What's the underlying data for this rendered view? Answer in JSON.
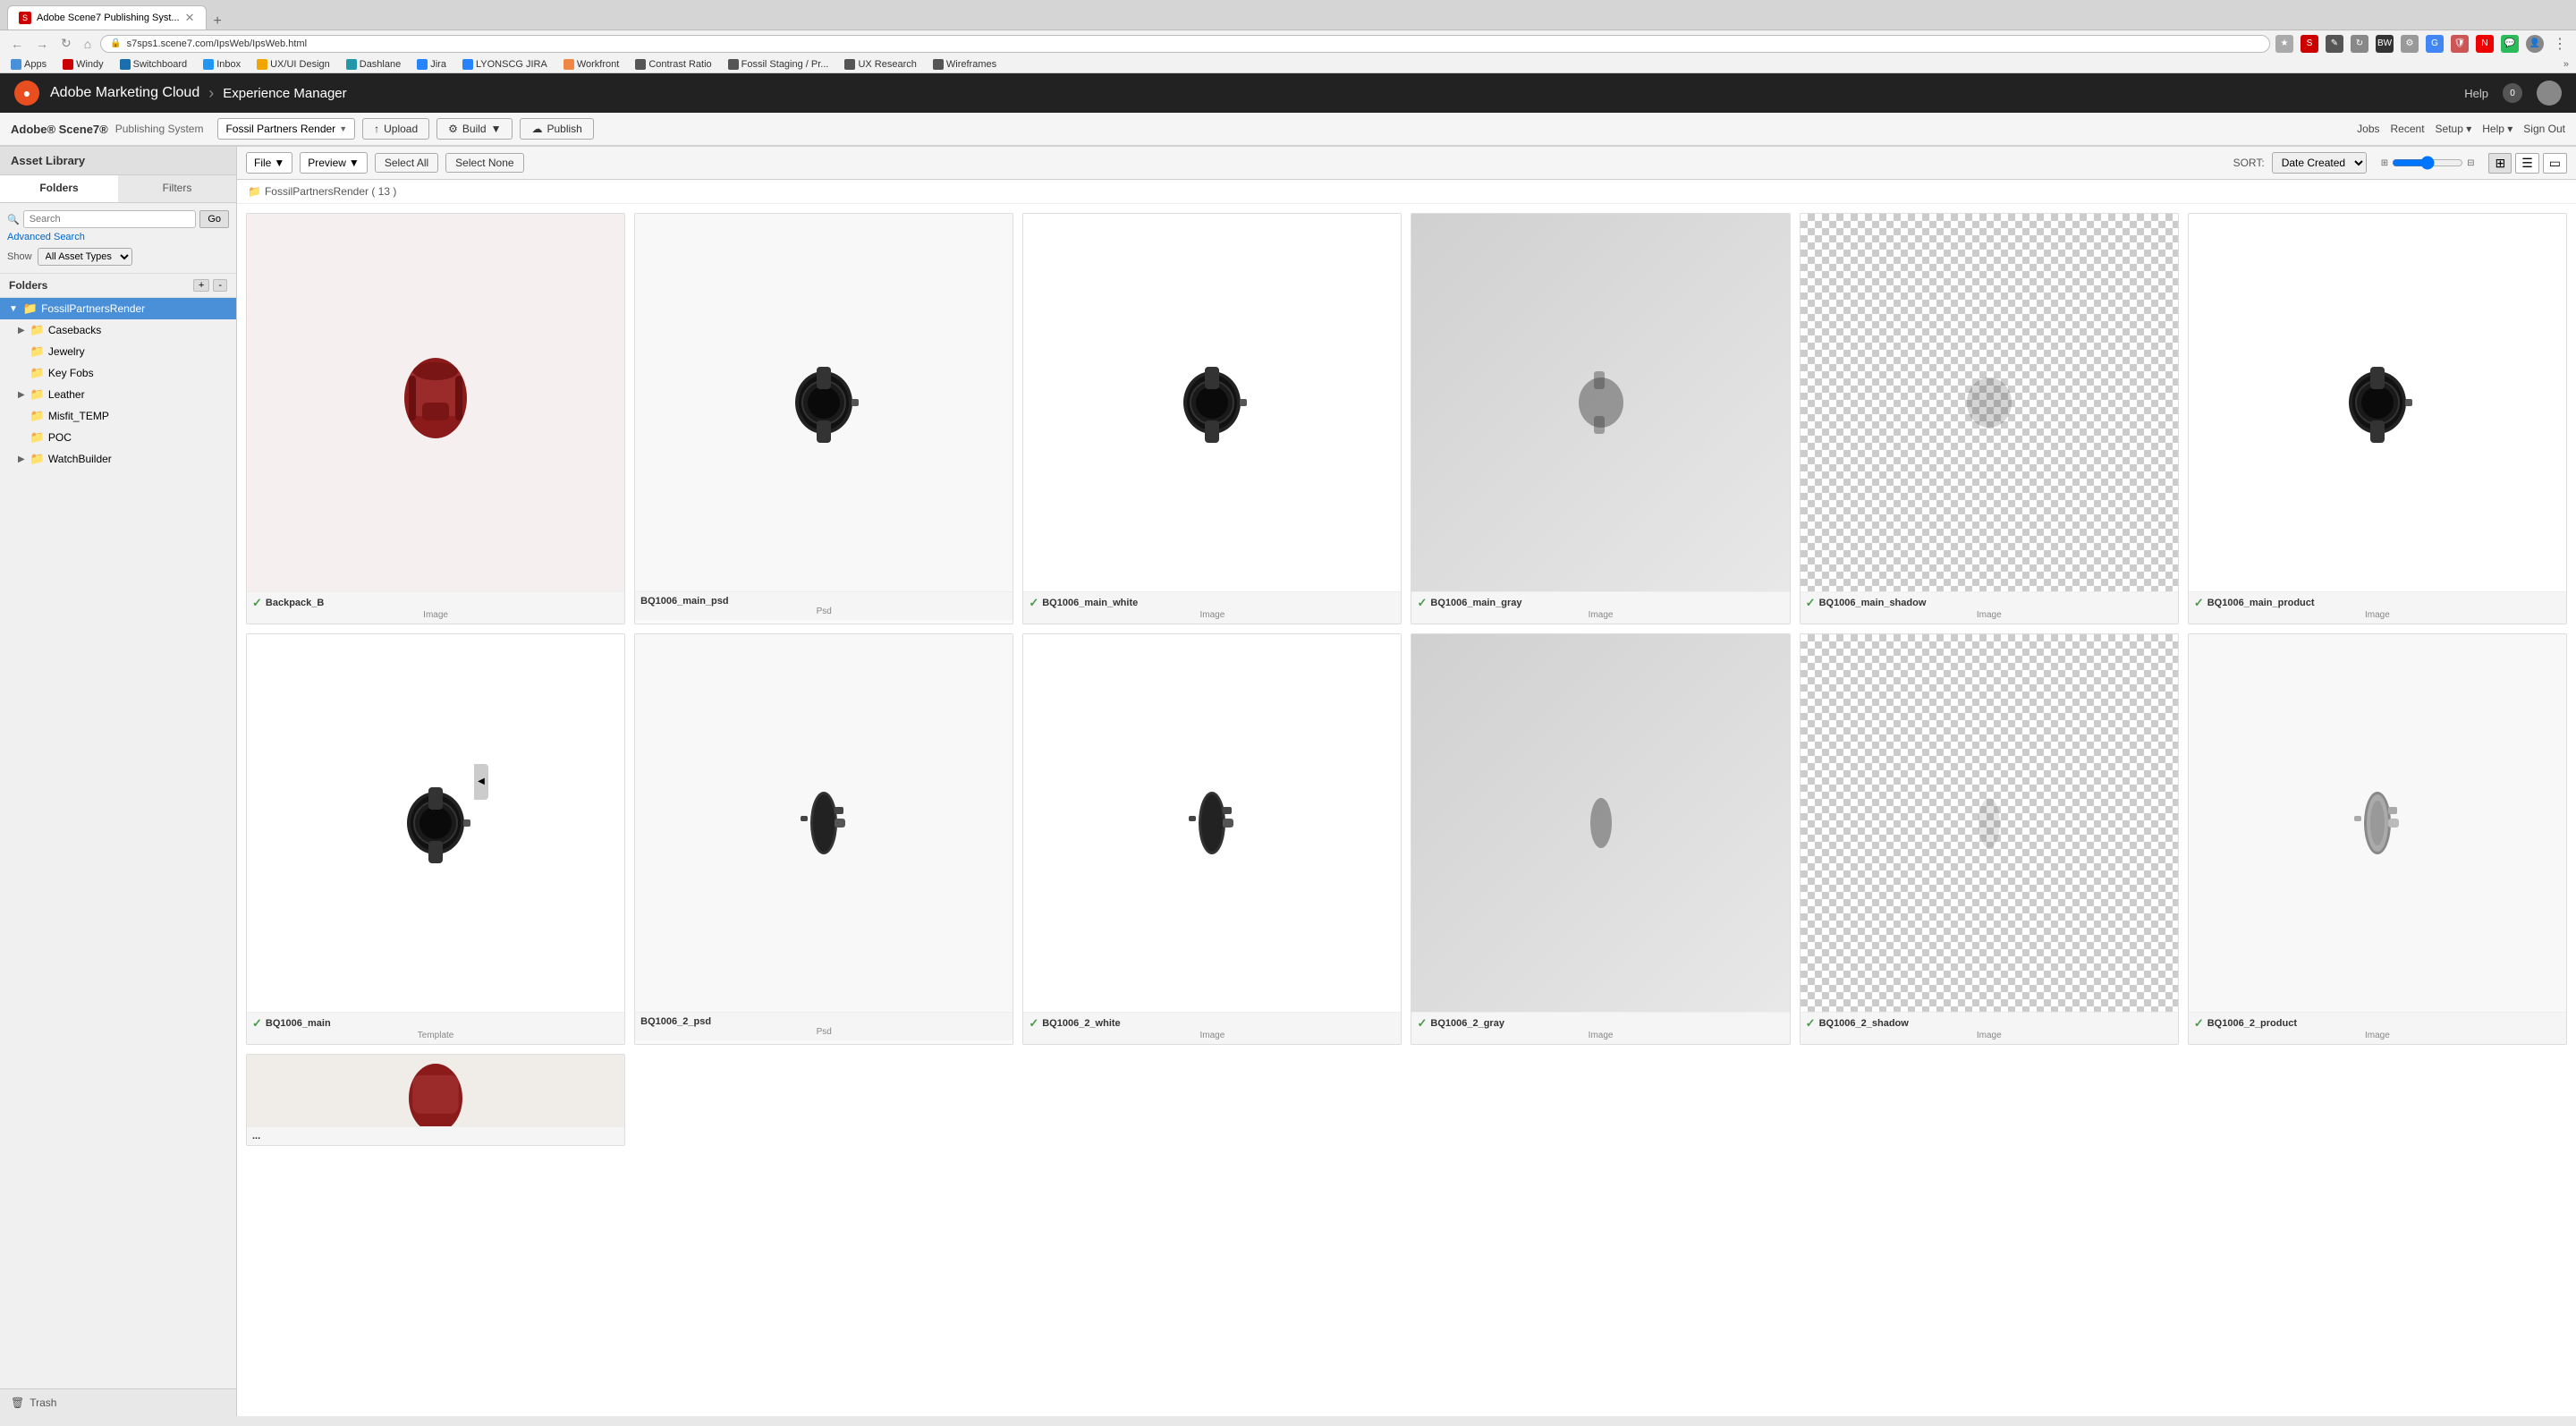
{
  "browser": {
    "tab_label": "Adobe Scene7 Publishing Syst...",
    "tab_plus": "+",
    "address": "s7sps1.scene7.com/IpsWeb/IpsWeb.html",
    "back": "←",
    "forward": "→",
    "refresh": "↻",
    "home": "⌂",
    "more": "⋯"
  },
  "bookmarks": [
    {
      "label": "Apps",
      "color": "#4a90d9"
    },
    {
      "label": "Windy",
      "color": "#c00"
    },
    {
      "label": "Switchboard",
      "color": "#1a6faf"
    },
    {
      "label": "Inbox",
      "color": "#2196F3"
    },
    {
      "label": "UX/UI Design",
      "color": "#f0a500"
    },
    {
      "label": "Dashlane",
      "color": "#29a"
    },
    {
      "label": "Jira",
      "color": "#2684FF"
    },
    {
      "label": "LYONSCG JIRA",
      "color": "#2684FF"
    },
    {
      "label": "Workfront",
      "color": "#e84"
    },
    {
      "label": "Contrast Ratio",
      "color": "#555"
    },
    {
      "label": "Fossil Staging / Pr...",
      "color": "#555"
    },
    {
      "label": "UX Research",
      "color": "#555"
    },
    {
      "label": "Wireframes",
      "color": "#555"
    }
  ],
  "app_header": {
    "logo": "●",
    "title": "Adobe Marketing Cloud",
    "separator": "›",
    "subtitle": "Experience Manager",
    "help": "Help",
    "notification_count": "0"
  },
  "pub_bar": {
    "brand": "Adobe® Scene7®",
    "system": "Publishing System",
    "dropdown_label": "Fossil Partners Render",
    "btn_upload": "Upload",
    "btn_build": "Build",
    "btn_publish": "Publish",
    "jobs": "Jobs",
    "recent": "Recent",
    "setup": "Setup ▾",
    "help": "Help ▾",
    "signout": "Sign Out"
  },
  "sidebar": {
    "title": "Asset Library",
    "tabs": [
      "Folders",
      "Filters"
    ],
    "search_placeholder": "Search",
    "search_go": "Go",
    "advanced_search": "Advanced Search",
    "show_label": "Show",
    "show_options": [
      "All Asset Types"
    ],
    "folders_label": "Folders",
    "folders_add": "+",
    "folders_remove": "-",
    "tree": [
      {
        "label": "FossilPartnersRender",
        "level": 0,
        "expanded": true,
        "selected": true,
        "has_children": true
      },
      {
        "label": "Casebacks",
        "level": 1,
        "expanded": false,
        "has_children": true
      },
      {
        "label": "Jewelry",
        "level": 1,
        "expanded": false,
        "has_children": false
      },
      {
        "label": "Key Fobs",
        "level": 1,
        "expanded": false,
        "has_children": false
      },
      {
        "label": "Leather",
        "level": 1,
        "expanded": false,
        "has_children": true
      },
      {
        "label": "Misfit_TEMP",
        "level": 1,
        "expanded": false,
        "has_children": false
      },
      {
        "label": "POC",
        "level": 1,
        "expanded": false,
        "has_children": false
      },
      {
        "label": "WatchBuilder",
        "level": 1,
        "expanded": false,
        "has_children": true
      }
    ],
    "trash": "Trash"
  },
  "content": {
    "file_label": "File",
    "preview_label": "Preview",
    "select_all": "Select All",
    "select_none": "Select None",
    "sort_label": "SORT:",
    "sort_option": "Date Created",
    "folder_path": "FossilPartnersRender ( 13 )",
    "assets": [
      {
        "name": "Backpack_B",
        "type": "Image",
        "published": true,
        "has_bg": false,
        "color": "#8B0000",
        "shape": "backpack"
      },
      {
        "name": "BQ1006_main_psd",
        "type": "Psd",
        "published": false,
        "has_bg": false,
        "shape": "watch"
      },
      {
        "name": "BQ1006_main_white",
        "type": "Image",
        "published": true,
        "has_bg": false,
        "shape": "watch_white"
      },
      {
        "name": "BQ1006_main_gray",
        "type": "Image",
        "published": true,
        "has_bg": true,
        "shape": "gray"
      },
      {
        "name": "BQ1006_main_shadow",
        "type": "Image",
        "published": true,
        "has_bg": true,
        "shape": "checker"
      },
      {
        "name": "BQ1006_main_product",
        "type": "Image",
        "published": true,
        "has_bg": false,
        "shape": "watch_product"
      },
      {
        "name": "BQ1006_main",
        "type": "Template",
        "published": true,
        "has_bg": false,
        "shape": "watch2"
      },
      {
        "name": "BQ1006_2_psd",
        "type": "Psd",
        "published": false,
        "has_bg": false,
        "shape": "watch_side"
      },
      {
        "name": "BQ1006_2_white",
        "type": "Image",
        "published": true,
        "has_bg": false,
        "shape": "watch_white2"
      },
      {
        "name": "BQ1006_2_gray",
        "type": "Image",
        "published": true,
        "has_bg": true,
        "shape": "gray2"
      },
      {
        "name": "BQ1006_2_shadow",
        "type": "Image",
        "published": true,
        "has_bg": true,
        "shape": "checker2"
      },
      {
        "name": "BQ1006_2_product",
        "type": "Image",
        "published": true,
        "has_bg": false,
        "shape": "watch_product2"
      }
    ]
  }
}
